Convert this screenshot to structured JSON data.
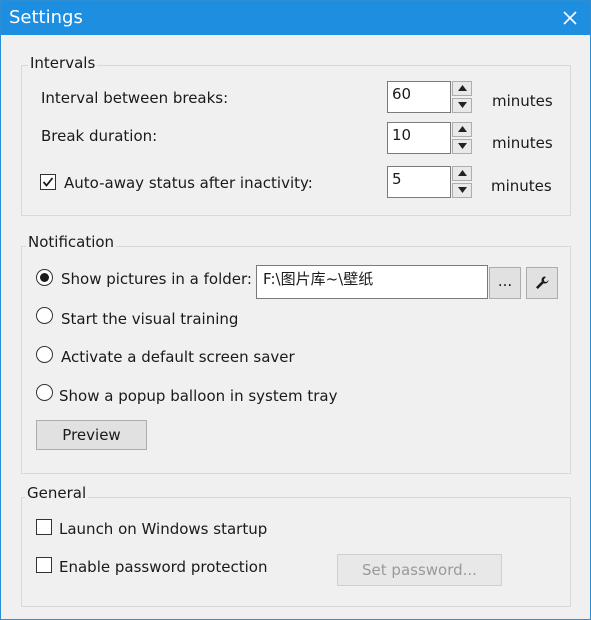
{
  "window": {
    "title": "Settings"
  },
  "intervals": {
    "group_title": "Intervals",
    "rows": [
      {
        "label": "Interval between breaks:",
        "value": "60",
        "unit": "minutes"
      },
      {
        "label": "Break duration:",
        "value": "10",
        "unit": "minutes"
      },
      {
        "label": "Auto-away status after inactivity:",
        "value": "5",
        "unit": "minutes",
        "checked": true
      }
    ]
  },
  "notification": {
    "group_title": "Notification",
    "options": [
      {
        "label": "Show pictures in a folder:",
        "selected": true
      },
      {
        "label": "Start the visual training",
        "selected": false
      },
      {
        "label": "Activate a default screen saver",
        "selected": false
      },
      {
        "label": "Show a popup balloon in system tray",
        "selected": false
      }
    ],
    "folder_path": "F:\\图片库~\\壁纸",
    "browse_label": "...",
    "tool_icon": "wrench-icon",
    "preview_label": "Preview"
  },
  "general": {
    "group_title": "General",
    "launch_label": "Launch on Windows startup",
    "launch_checked": false,
    "password_label": "Enable password protection",
    "password_checked": false,
    "set_password_label": "Set password..."
  },
  "colors": {
    "titlebar": "#1e8fe0",
    "accent": "#2b8fd6"
  }
}
